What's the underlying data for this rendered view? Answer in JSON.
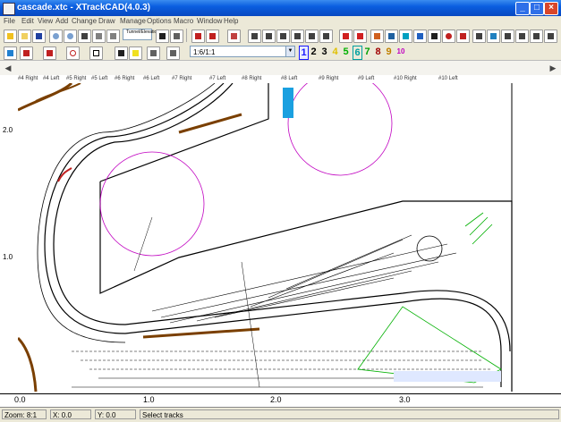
{
  "window": {
    "title": "cascade.xtc - XTrackCAD(4.0.3)",
    "min": "_",
    "max": "□",
    "close": "×"
  },
  "menu": [
    "File",
    "Edit",
    "View",
    "Add",
    "Change",
    "Draw",
    "Manage",
    "Options",
    "Macro",
    "Window",
    "Help"
  ],
  "toolbar": {
    "elevation_button": "Tunnel/Elevation",
    "scale_select": "1:6/1:1",
    "layer_numbers": [
      "1",
      "2",
      "3",
      "4",
      "5",
      "6",
      "7",
      "8",
      "9",
      "10"
    ],
    "layer_colors": [
      "#1a1aff",
      "#000000",
      "#000000",
      "#e0c000",
      "#00b000",
      "#00a0a0",
      "#00a000",
      "#a00000",
      "#c08000",
      "#c000c0"
    ]
  },
  "tabs": [
    "#4 Right",
    "#4 Left",
    "#5 Right",
    "#5 Left",
    "#6 Right",
    "#6 Left",
    "#7 Right",
    "#7 Left",
    "#8 Right",
    "#8 Left",
    "#9 Right",
    "#9 Left",
    "#10 Right",
    "#10 Left"
  ],
  "ruler": {
    "vertical": [
      "2.0",
      "1.0"
    ],
    "horizontal": [
      "0.0",
      "1.0",
      "2.0",
      "3.0"
    ]
  },
  "status": {
    "zoom": "Zoom: 8:1",
    "grid": "X: 0.0",
    "ypos": "Y: 0.0",
    "mode": "Select tracks"
  }
}
